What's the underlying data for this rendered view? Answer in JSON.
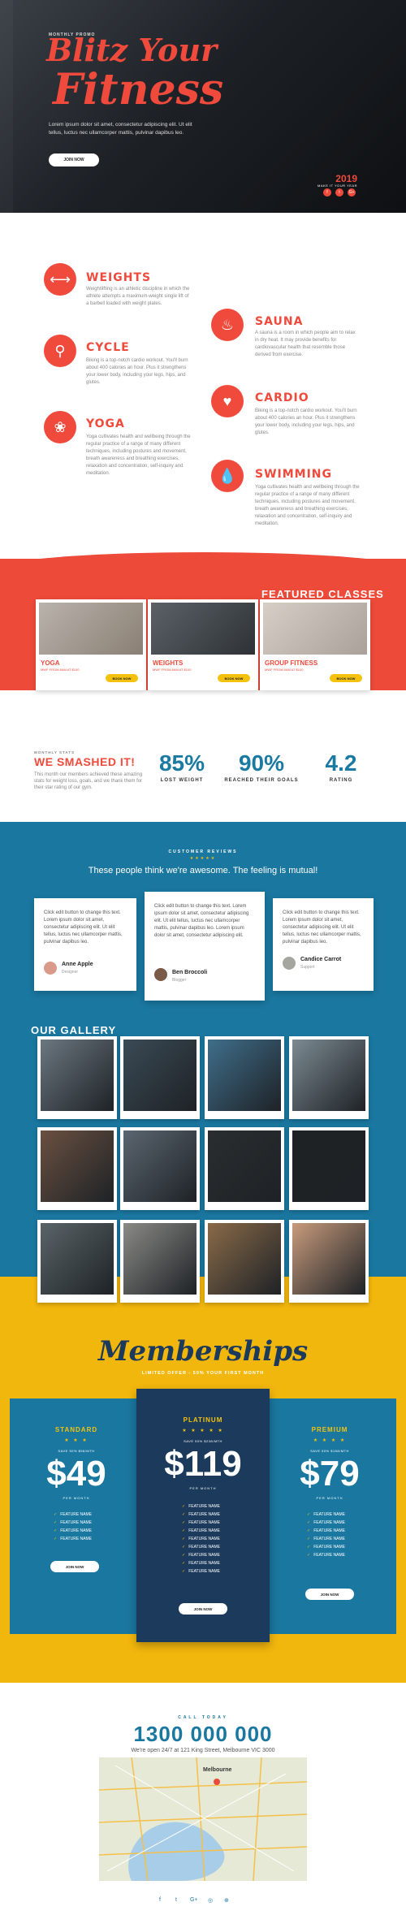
{
  "hero": {
    "eyebrow": "MONTHLY PROMO",
    "title_line1": "Blitz Your",
    "title_line2": "Fitness",
    "description": "Lorem ipsum dolor sit amet, consectetur adipiscing elit. Ut elit tellus, luctus nec ullamcorper mattis, pulvinar dapibus leo.",
    "button": "JOIN NOW",
    "year": "2019",
    "year_sub": "MAKE IT YOUR YEAR",
    "social": [
      "f",
      "t",
      "G+"
    ]
  },
  "classes": [
    {
      "icon": "dumbbell-icon",
      "glyph": "⟷",
      "title": "WEIGHTS",
      "desc": "Weightlifting is an athletic discipline in which the athlete attempts a maximum-weight single lift of a barbell loaded with weight plates."
    },
    {
      "icon": "flame-icon",
      "glyph": "♨",
      "title": "SAUNA",
      "desc": "A sauna is a room in which people aim to relax in dry heat. It may provide benefits for cardiovascular health that resemble those derived from exercise."
    },
    {
      "icon": "bicycle-icon",
      "glyph": "⚲",
      "title": "CYCLE",
      "desc": "Biking is a top-notch cardio workout. You'll burn about 400 calories an hour. Plus it strengthens your lower body, including your legs, hips, and glutes."
    },
    {
      "icon": "heartbeat-icon",
      "glyph": "♥",
      "title": "CARDIO",
      "desc": "Biking is a top-notch cardio workout. You'll burn about 400 calories an hour. Plus it strengthens your lower body, including your legs, hips, and glutes."
    },
    {
      "icon": "lotus-icon",
      "glyph": "❀",
      "title": "YOGA",
      "desc": "Yoga cultivates health and wellbeing through the regular practice of a range of many different techniques, including postures and movement, breath awareness and breathing exercises, relaxation and concentration, self-inquiry and meditation."
    },
    {
      "icon": "water-drop-icon",
      "glyph": "💧",
      "title": "SWIMMING",
      "desc": "Yoga cultivates health and wellbeing through the regular practice of a range of many different techniques, including postures and movement, breath awareness and breathing exercises, relaxation and concentration, self-inquiry and meditation."
    }
  ],
  "featured": {
    "title": "FEATURED CLASSES",
    "cards": [
      {
        "title": "YOGA",
        "sub": "MWF FROM 8AM AT $100",
        "button": "BOOK NOW"
      },
      {
        "title": "WEIGHTS",
        "sub": "MWF FROM 8AM AT $100",
        "button": "BOOK NOW"
      },
      {
        "title": "GROUP FITNESS",
        "sub": "MWF FROM 8AM AT $100",
        "button": "BOOK NOW"
      }
    ]
  },
  "stats": {
    "eyebrow": "MONTHLY STATS",
    "title": "WE SMASHED IT!",
    "desc": "This month our members achieved these amazing stats for weight loss, goals, and we thank them for their star rating of our gym.",
    "items": [
      {
        "value": "85%",
        "label": "LOST WEIGHT"
      },
      {
        "value": "90%",
        "label": "REACHED THEIR GOALS"
      },
      {
        "value": "4.2",
        "label": "RATING"
      }
    ]
  },
  "reviews": {
    "eyebrow": "CUSTOMER REVIEWS",
    "stars": "★★★★★",
    "title": "These people think we're awesome. The feeling is mutual!",
    "items": [
      {
        "text": "Click edit button to change this text. Lorem ipsum dolor sit amet, consectetur adipiscing elit. Ut elit tellus, luctus nec ullamcorper mattis, pulvinar dapibus leo.",
        "name": "Anne Apple",
        "role": "Designer"
      },
      {
        "text": "Click edit button to change this text. Lorem ipsum dolor sit amet, consectetur adipiscing elit. Ut elit tellus, luctus nec ullamcorper mattis, pulvinar dapibus leo. Lorem ipsum dolor sit amet, consectetur adipiscing elit.",
        "name": "Ben Broccoli",
        "role": "Blogger"
      },
      {
        "text": "Click edit button to change this text. Lorem ipsum dolor sit amet, consectetur adipiscing elit. Ut elit tellus, luctus nec ullamcorper mattis, pulvinar dapibus leo.",
        "name": "Candice Carrot",
        "role": "Support"
      }
    ]
  },
  "gallery": {
    "title": "OUR GALLERY",
    "colors": [
      "#6b7780",
      "#3a4a55",
      "#3f6e8a",
      "#7c8a92",
      "#6a5040",
      "#5b6670",
      "#2a2d30",
      "#1f2224",
      "#5a6468",
      "#8a8a86",
      "#8a6a48",
      "#c89b7c"
    ]
  },
  "memberships": {
    "title": "Memberships",
    "subtitle": "LIMITED OFFER - 50% YOUR FIRST MONTH",
    "plans": [
      {
        "name": "STANDARD",
        "stars": "★ ★ ★",
        "save": "SAVE 50% $98/MTH",
        "price": "$49",
        "period": "PER MONTH",
        "features": [
          "FEATURE NAME",
          "FEATURE NAME",
          "FEATURE NAME",
          "FEATURE NAME"
        ],
        "button": "JOIN NOW"
      },
      {
        "name": "PLATINUM",
        "stars": "★ ★ ★ ★ ★",
        "save": "SAVE 50% $238/MTH",
        "price": "$119",
        "period": "PER MONTH",
        "features": [
          "FEATURE NAME",
          "FEATURE NAME",
          "FEATURE NAME",
          "FEATURE NAME",
          "FEATURE NAME",
          "FEATURE NAME",
          "FEATURE NAME",
          "FEATURE NAME",
          "FEATURE NAME"
        ],
        "button": "JOIN NOW"
      },
      {
        "name": "PREMIUM",
        "stars": "★ ★ ★ ★",
        "save": "SAVE 50% $158/MTH",
        "price": "$79",
        "period": "PER MONTH",
        "features": [
          "FEATURE NAME",
          "FEATURE NAME",
          "FEATURE NAME",
          "FEATURE NAME",
          "FEATURE NAME",
          "FEATURE NAME"
        ],
        "button": "JOIN NOW"
      }
    ]
  },
  "contact": {
    "eyebrow": "CALL TODAY",
    "phone": "1300 000 000",
    "address": "We're open 24/7 at 121 King Street, Melbourne VIC 3000",
    "map_label": "Melbourne",
    "social": [
      "f",
      "t",
      "G+",
      "◎",
      "⊕"
    ]
  },
  "accent": "#ee4a3a",
  "blue": "#1a77a0",
  "yellow": "#f2b70d"
}
